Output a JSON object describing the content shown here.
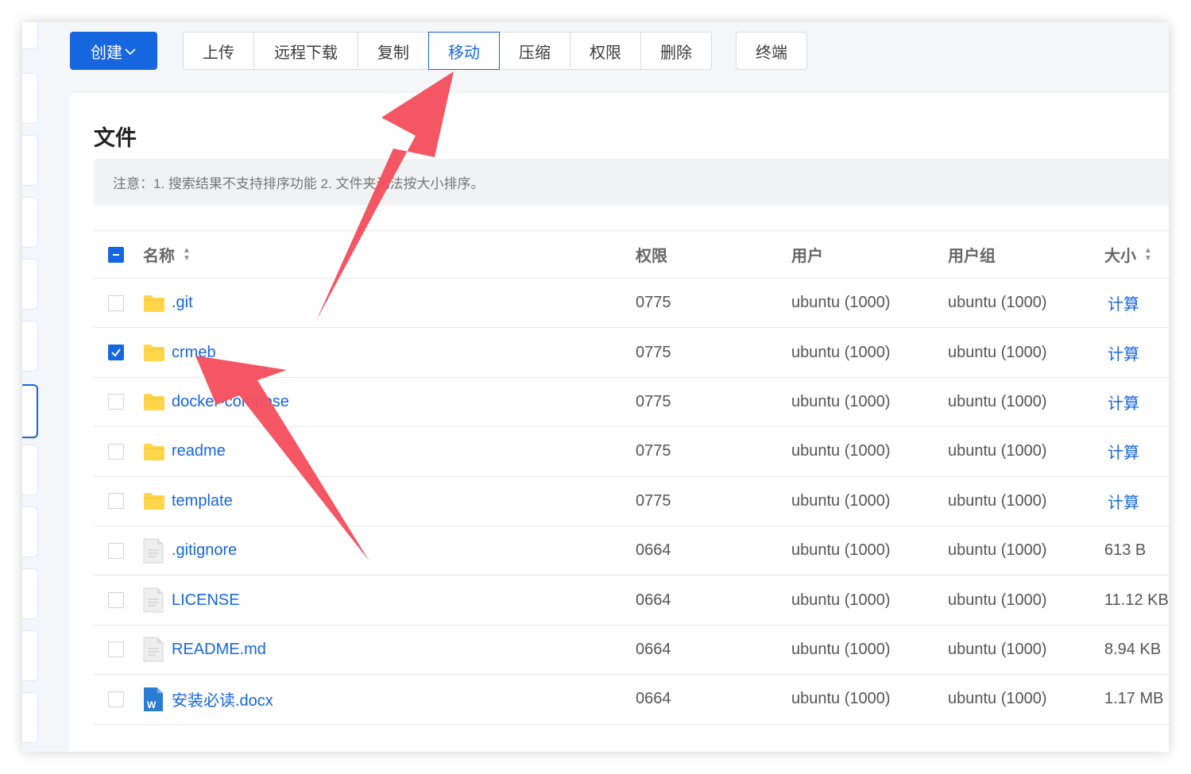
{
  "toolbar": {
    "create_label": "创建",
    "buttons": [
      {
        "label": "上传"
      },
      {
        "label": "远程下载"
      },
      {
        "label": "复制"
      },
      {
        "label": "移动"
      },
      {
        "label": "压缩"
      },
      {
        "label": "权限"
      },
      {
        "label": "删除"
      }
    ],
    "terminal_label": "终端"
  },
  "files_panel": {
    "title": "文件",
    "notice": "注意：1. 搜索结果不支持排序功能 2. 文件夹无法按大小排序。",
    "columns": {
      "name": "名称",
      "permission": "权限",
      "user": "用户",
      "group": "用户组",
      "size": "大小"
    },
    "calc_label": "计算",
    "rows": [
      {
        "name": ".git",
        "type": "folder",
        "permission": "0775",
        "user": "ubuntu (1000)",
        "group": "ubuntu (1000)",
        "size": "",
        "checked": false
      },
      {
        "name": "crmeb",
        "type": "folder",
        "permission": "0775",
        "user": "ubuntu (1000)",
        "group": "ubuntu (1000)",
        "size": "",
        "checked": true
      },
      {
        "name": "docker-compose",
        "type": "folder",
        "permission": "0775",
        "user": "ubuntu (1000)",
        "group": "ubuntu (1000)",
        "size": "",
        "checked": false
      },
      {
        "name": "readme",
        "type": "folder",
        "permission": "0775",
        "user": "ubuntu (1000)",
        "group": "ubuntu (1000)",
        "size": "",
        "checked": false
      },
      {
        "name": "template",
        "type": "folder",
        "permission": "0775",
        "user": "ubuntu (1000)",
        "group": "ubuntu (1000)",
        "size": "",
        "checked": false
      },
      {
        "name": ".gitignore",
        "type": "file",
        "permission": "0664",
        "user": "ubuntu (1000)",
        "group": "ubuntu (1000)",
        "size": "613 B",
        "checked": false
      },
      {
        "name": "LICENSE",
        "type": "file",
        "permission": "0664",
        "user": "ubuntu (1000)",
        "group": "ubuntu (1000)",
        "size": "11.12 KB",
        "checked": false
      },
      {
        "name": "README.md",
        "type": "file",
        "permission": "0664",
        "user": "ubuntu (1000)",
        "group": "ubuntu (1000)",
        "size": "8.94 KB",
        "checked": false
      },
      {
        "name": "安装必读.docx",
        "type": "word",
        "permission": "0664",
        "user": "ubuntu (1000)",
        "group": "ubuntu (1000)",
        "size": "1.17 MB",
        "checked": false
      }
    ]
  },
  "colors": {
    "primary": "#1666e0",
    "folder": "#ffd54a",
    "annotation_arrow": "#f4515f"
  },
  "icons": {
    "folder": "folder-icon",
    "file": "file-icon",
    "word": "word-doc-icon",
    "sort": "sort-caret-icon",
    "dropdown": "chevron-down-icon"
  }
}
